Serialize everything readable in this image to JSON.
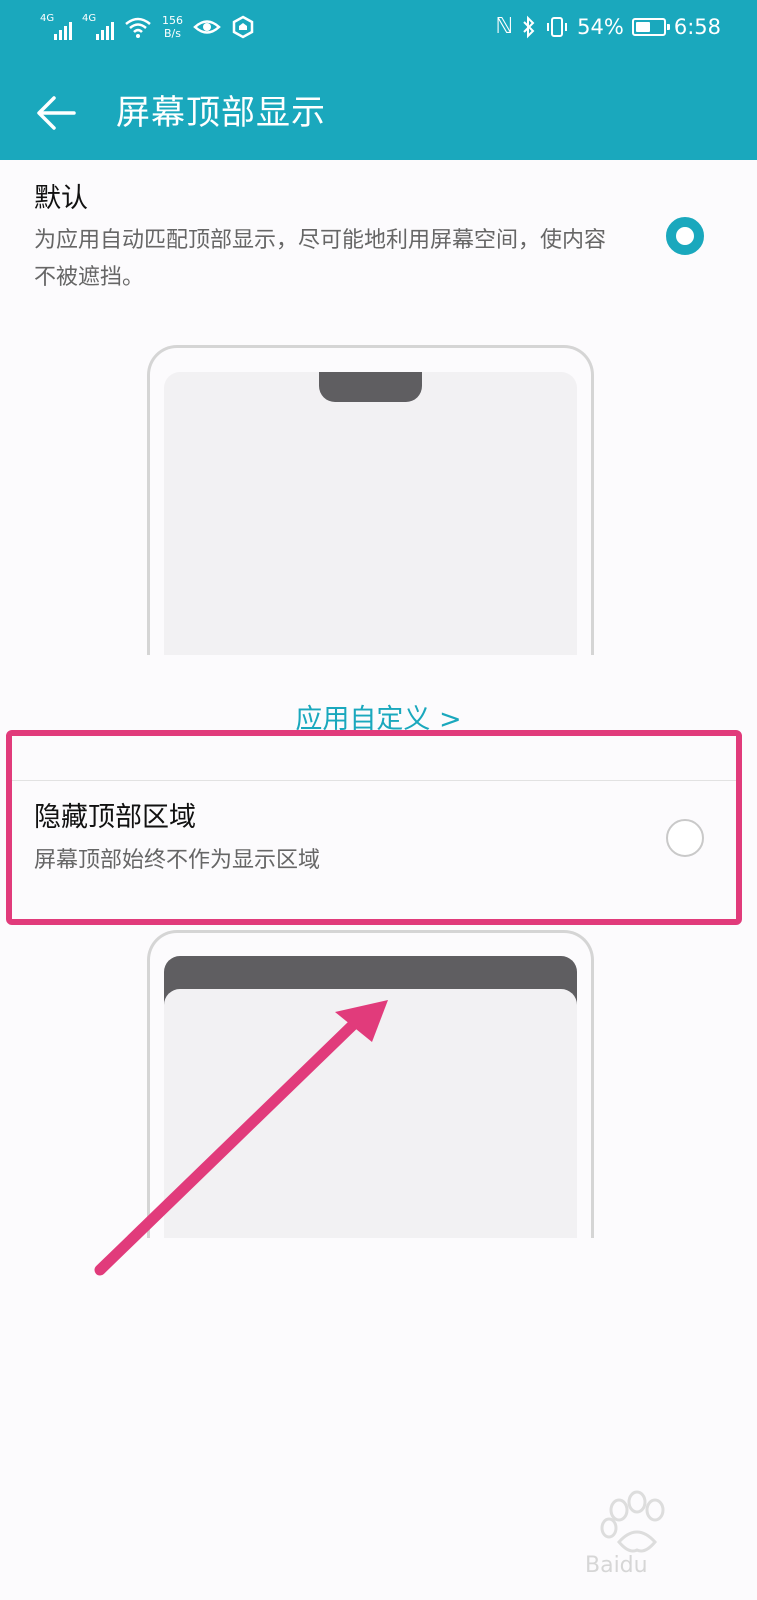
{
  "status_bar": {
    "network_1": "4G",
    "network_2": "4G",
    "speed_value": "156",
    "speed_unit": "B/s",
    "battery": "54%",
    "battery_level": 0.54,
    "time": "6:58"
  },
  "header": {
    "title": "屏幕顶部显示"
  },
  "options": [
    {
      "title": "默认",
      "description": "为应用自动匹配顶部显示，尽可能地利用屏幕空间，使内容不被遮挡。",
      "selected": true
    },
    {
      "title": "隐藏顶部区域",
      "description": "屏幕顶部始终不作为显示区域",
      "selected": false
    }
  ],
  "custom_link": {
    "label": "应用自定义 >"
  },
  "colors": {
    "accent": "#1aa8bd",
    "annotation": "#e13b7b"
  }
}
